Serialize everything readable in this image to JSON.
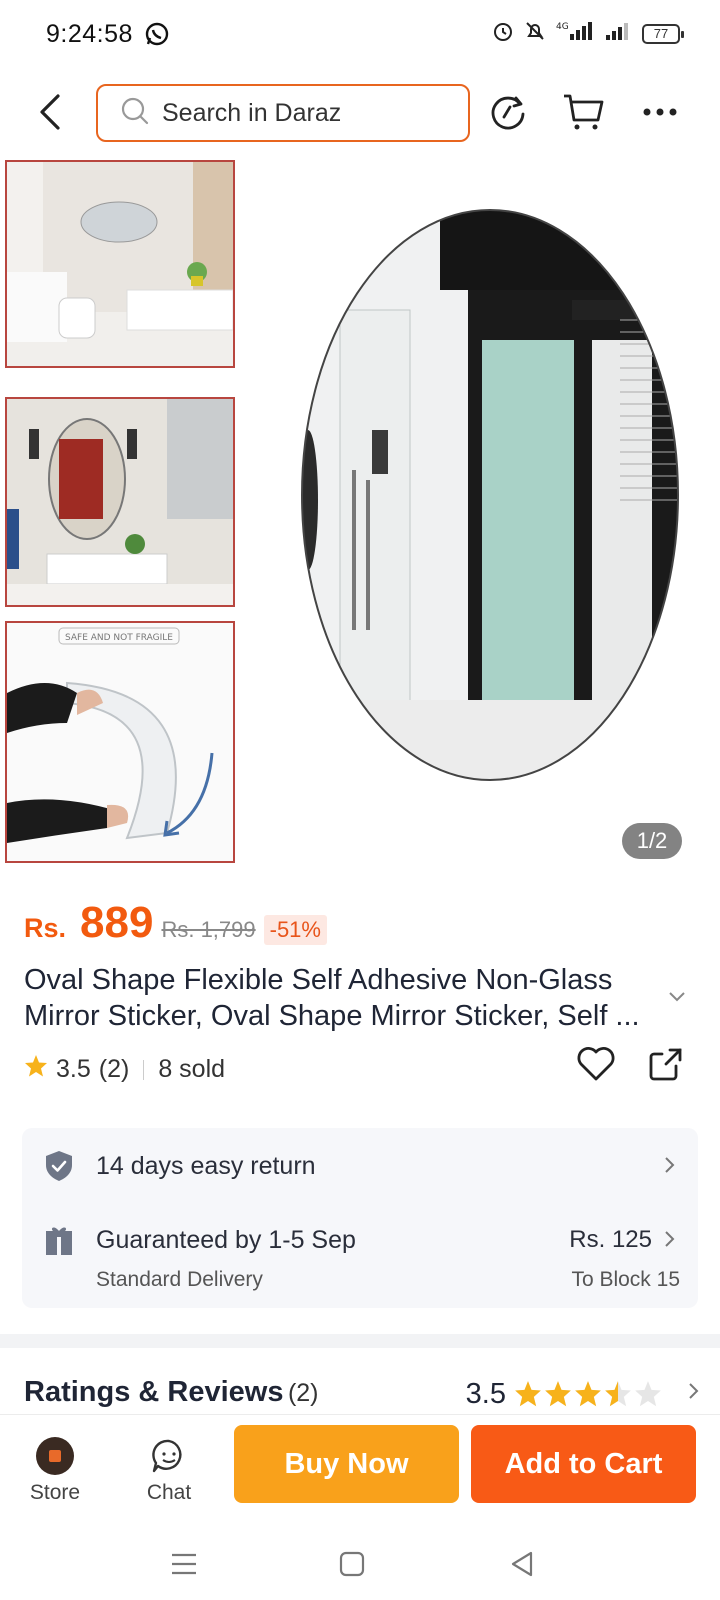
{
  "status_bar": {
    "time": "9:24:58",
    "battery": "77"
  },
  "search": {
    "placeholder": "Search in Daraz"
  },
  "gallery": {
    "counter": "1/2",
    "thumb3_caption": "SAFE AND NOT FRAGILE"
  },
  "price": {
    "currency": "Rs.",
    "amount": "889",
    "original": "Rs. 1,799",
    "discount": "-51%"
  },
  "product": {
    "title": "Oval Shape Flexible Self Adhesive Non-Glass Mirror Sticker, Oval Shape Mirror Sticker, Self ...",
    "rating": "3.5",
    "rating_count": "(2)",
    "sold": "8 sold"
  },
  "service": {
    "return_text": "14 days easy return",
    "delivery_text": "Guaranteed by 1-5 Sep",
    "delivery_type": "Standard Delivery",
    "delivery_fee": "Rs. 125",
    "delivery_dest": "To Block 15"
  },
  "reviews": {
    "title": "Ratings & Reviews",
    "count": "(2)",
    "score": "3.5",
    "stars": 3.5
  },
  "action_bar": {
    "store_label": "Store",
    "chat_label": "Chat",
    "buy_now": "Buy Now",
    "add_to_cart": "Add to Cart"
  },
  "colors": {
    "accent": "#f85a16",
    "buy_now": "#f9a11b",
    "star": "#f7b21b"
  }
}
